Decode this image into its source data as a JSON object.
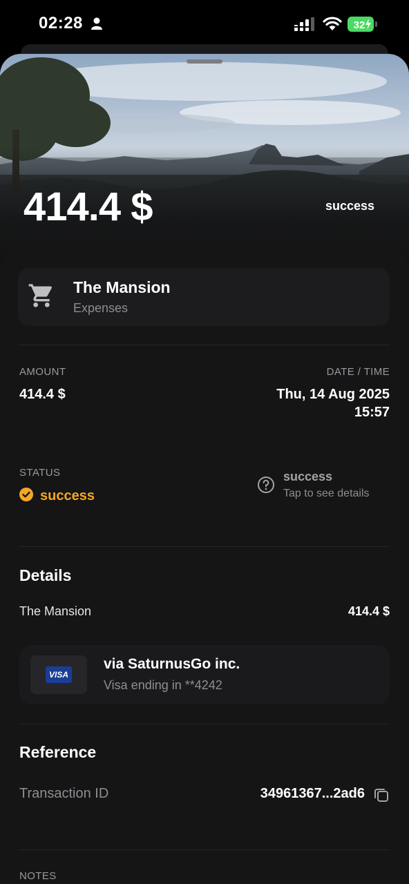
{
  "status_bar": {
    "time": "02:28",
    "battery": "32"
  },
  "hero": {
    "amount": "414.4 $",
    "status": "success"
  },
  "merchant": {
    "name": "The Mansion",
    "category": "Expenses",
    "icon": "cart-icon"
  },
  "summary": {
    "amount_label": "AMOUNT",
    "amount_value": "414.4 $",
    "datetime_label": "DATE / TIME",
    "date": "Thu, 14 Aug 2025",
    "time": "15:57",
    "status_label": "STATUS",
    "status_value": "success",
    "status_color": "#f5a623",
    "help_title": "success",
    "help_subtitle": "Tap to see details"
  },
  "details": {
    "title": "Details",
    "item_name": "The Mansion",
    "item_amount": "414.4 $",
    "payment": {
      "via": "via SaturnusGo inc.",
      "card": "Visa ending in **4242",
      "brand": "VISA"
    }
  },
  "reference": {
    "title": "Reference",
    "tx_label": "Transaction ID",
    "tx_value": "34961367...2ad6"
  },
  "notes": {
    "label": "NOTES"
  }
}
